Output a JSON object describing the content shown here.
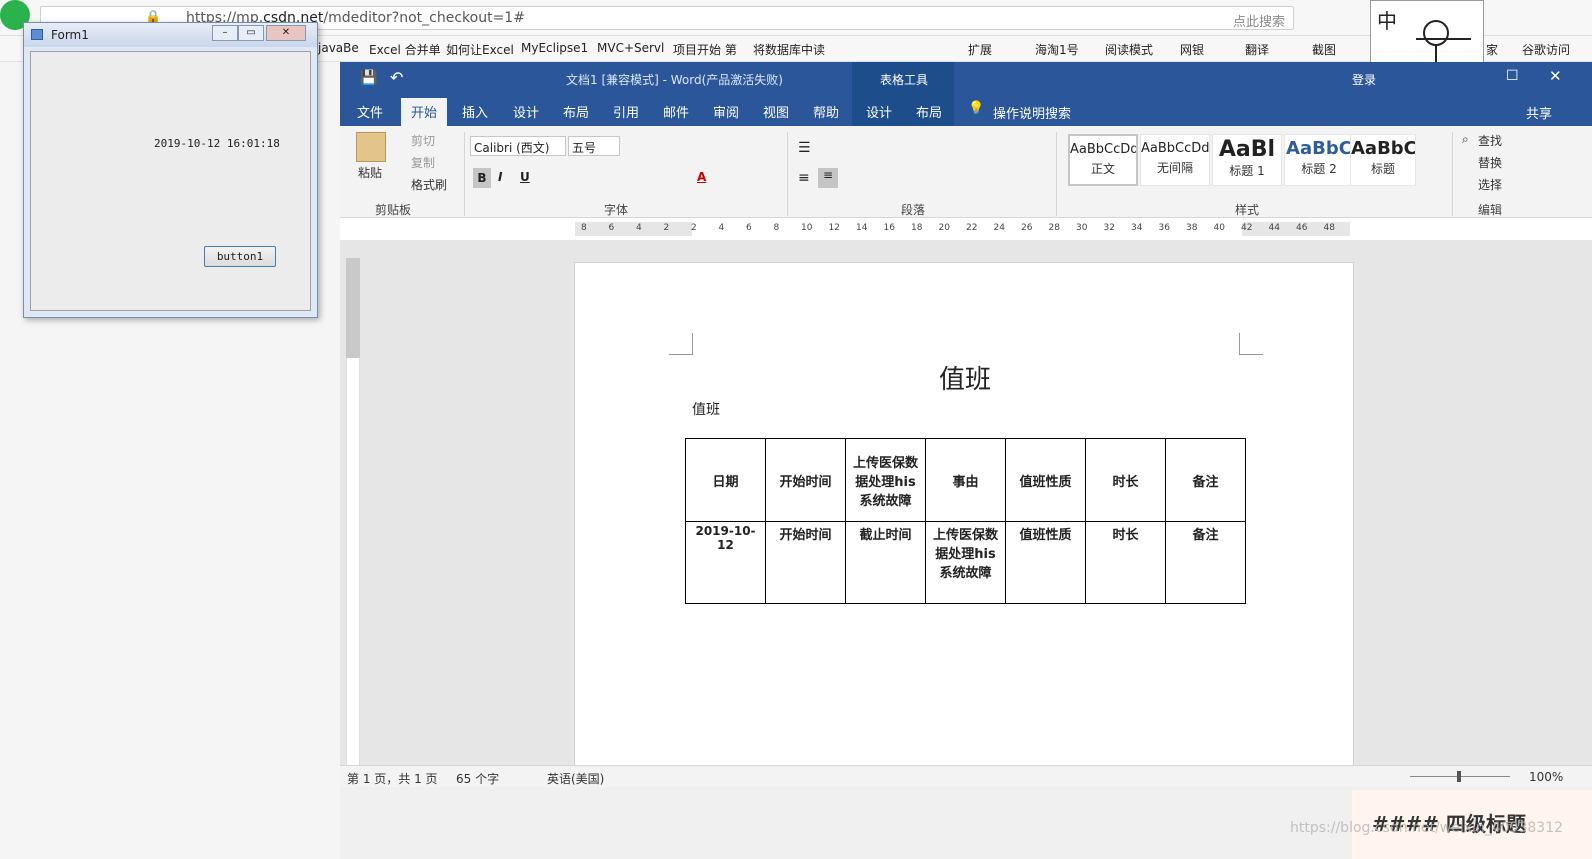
{
  "browser": {
    "url_prefix": "https://mp.",
    "url_domain": "csdn.net",
    "url_path": "/mdeditor?not_checkout=1#",
    "search_placeholder": "点此搜索",
    "bookmarks": [
      "javaBe",
      "Excel 合并单",
      "如何让Excel",
      "MyEclipse1",
      "MVC+Servl",
      "项目开始 第",
      "将数据库中读"
    ],
    "ext": [
      "扩展",
      "海淘1号",
      "阅读模式",
      "网银",
      "翻译",
      "截图",
      "家",
      "谷歌访问"
    ]
  },
  "ime": {
    "label": "中"
  },
  "word": {
    "title": "文档1 [兼容模式] - Word(产品激活失败)",
    "context_tools": "表格工具",
    "login": "登录",
    "tabs": [
      "文件",
      "开始",
      "插入",
      "设计",
      "布局",
      "引用",
      "邮件",
      "审阅",
      "视图",
      "帮助",
      "设计",
      "布局"
    ],
    "tell_me": "操作说明搜索",
    "share": "共享",
    "clipboard": {
      "paste": "粘贴",
      "cut": "剪切",
      "copy": "复制",
      "format_painter": "格式刷",
      "label": "剪贴板"
    },
    "font": {
      "name": "Calibri (西文)",
      "size": "五号",
      "label": "字体"
    },
    "paragraph_label": "段落",
    "styles": {
      "label": "样式",
      "items": [
        {
          "sample": "AaBbCcDd",
          "name": "正文"
        },
        {
          "sample": "AaBbCcDd",
          "name": "无间隔"
        },
        {
          "sample": "AaBl",
          "name": "标题 1"
        },
        {
          "sample": "AaBbC",
          "name": "标题 2"
        },
        {
          "sample": "AaBbC",
          "name": "标题"
        }
      ]
    },
    "editing": {
      "find": "查找",
      "replace": "替换",
      "select": "选择",
      "label": "编辑"
    },
    "ruler_numbers": [
      "8",
      "6",
      "4",
      "2",
      "2",
      "4",
      "6",
      "8",
      "10",
      "12",
      "14",
      "16",
      "18",
      "20",
      "22",
      "24",
      "26",
      "28",
      "30",
      "32",
      "34",
      "36",
      "38",
      "40",
      "42",
      "44",
      "46",
      "48"
    ],
    "doc": {
      "heading": "值班",
      "subheading": "值班",
      "table": {
        "header": [
          "日期",
          "开始时间",
          "上传医保数据处理his 系统故障",
          "事由",
          "值班性质",
          "时长",
          "备注"
        ],
        "row": [
          "2019-10-12",
          "开始时间",
          "截止时间",
          "上传医保数据处理his 系统故障",
          "值班性质",
          "时长",
          "备注"
        ]
      }
    },
    "status": {
      "page": "第 1 页，共 1 页",
      "words": "65 个字",
      "lang": "英语(美国)",
      "zoom": "100%"
    }
  },
  "form1": {
    "title": "Form1",
    "datetime": "2019-10-12 16:01:18",
    "button": "button1"
  },
  "csdn": {
    "heading": "#### 四级标题",
    "watermark": "https://blog.csdn.net/weixin_40938312"
  }
}
